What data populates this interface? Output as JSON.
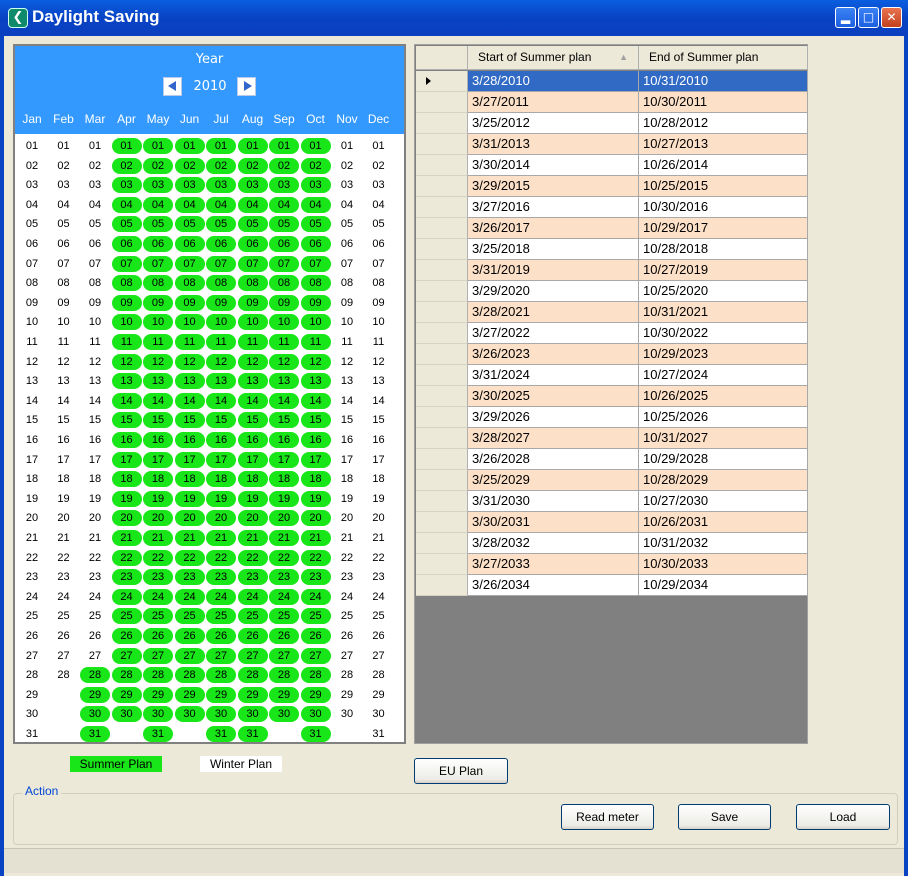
{
  "window": {
    "title": "Daylight Saving"
  },
  "calendar": {
    "year_label": "Year",
    "year": "2010",
    "months": [
      "Jan",
      "Feb",
      "Mar",
      "Apr",
      "May",
      "Jun",
      "Jul",
      "Aug",
      "Sep",
      "Oct",
      "Nov",
      "Dec"
    ],
    "days_in_month": [
      31,
      28,
      31,
      30,
      31,
      30,
      31,
      31,
      30,
      31,
      30,
      31
    ],
    "summer_ranges": [
      [
        3,
        28,
        31
      ],
      [
        4,
        1,
        30
      ],
      [
        5,
        1,
        31
      ],
      [
        6,
        1,
        30
      ],
      [
        7,
        1,
        31
      ],
      [
        8,
        1,
        31
      ],
      [
        9,
        1,
        30
      ],
      [
        10,
        1,
        31
      ]
    ],
    "summer_color": "#19e619"
  },
  "legend": {
    "summer": "Summer Plan",
    "winter": "Winter Plan"
  },
  "table": {
    "headers": [
      "Start of Summer plan",
      "End of Summer plan"
    ],
    "rows": [
      [
        "3/28/2010",
        "10/31/2010"
      ],
      [
        "3/27/2011",
        "10/30/2011"
      ],
      [
        "3/25/2012",
        "10/28/2012"
      ],
      [
        "3/31/2013",
        "10/27/2013"
      ],
      [
        "3/30/2014",
        "10/26/2014"
      ],
      [
        "3/29/2015",
        "10/25/2015"
      ],
      [
        "3/27/2016",
        "10/30/2016"
      ],
      [
        "3/26/2017",
        "10/29/2017"
      ],
      [
        "3/25/2018",
        "10/28/2018"
      ],
      [
        "3/31/2019",
        "10/27/2019"
      ],
      [
        "3/29/2020",
        "10/25/2020"
      ],
      [
        "3/28/2021",
        "10/31/2021"
      ],
      [
        "3/27/2022",
        "10/30/2022"
      ],
      [
        "3/26/2023",
        "10/29/2023"
      ],
      [
        "3/31/2024",
        "10/27/2024"
      ],
      [
        "3/30/2025",
        "10/26/2025"
      ],
      [
        "3/29/2026",
        "10/25/2026"
      ],
      [
        "3/28/2027",
        "10/31/2027"
      ],
      [
        "3/26/2028",
        "10/29/2028"
      ],
      [
        "3/25/2029",
        "10/28/2029"
      ],
      [
        "3/31/2030",
        "10/27/2030"
      ],
      [
        "3/30/2031",
        "10/26/2031"
      ],
      [
        "3/28/2032",
        "10/31/2032"
      ],
      [
        "3/27/2033",
        "10/30/2033"
      ],
      [
        "3/26/2034",
        "10/29/2034"
      ]
    ],
    "selected_row": 0,
    "alt_row_color": "#fce0c8",
    "selection_color": "#316ac5"
  },
  "buttons": {
    "eu_plan": "EU Plan",
    "read_meter": "Read meter",
    "save": "Save",
    "load": "Load"
  },
  "action_group": {
    "title": "Action"
  }
}
